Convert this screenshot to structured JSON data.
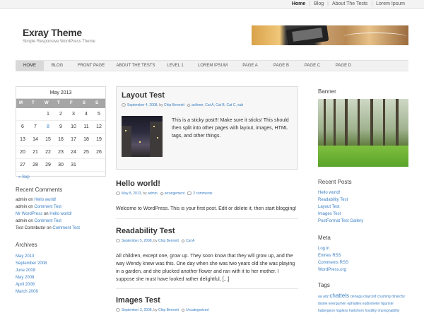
{
  "topnav": [
    "Home",
    "Blog",
    "About The Tests",
    "Lorem Ipsum"
  ],
  "site": {
    "title": "Exray Theme",
    "description": "Simple Responsive WordPress Theme"
  },
  "nav": [
    "HOME",
    "BLOG",
    "FRONT PAGE",
    "ABOUT THE TESTS",
    "LEVEL 1",
    "LOREM IPSUM",
    "PAGE A",
    "PAGE B",
    "PAGE C",
    "PAGE D"
  ],
  "calendar": {
    "caption": "May 2013",
    "days": [
      "M",
      "T",
      "W",
      "T",
      "F",
      "S",
      "S"
    ],
    "rows": [
      [
        "",
        "",
        "1",
        "2",
        "3",
        "4",
        "5"
      ],
      [
        "6",
        "7",
        "8",
        "9",
        "10",
        "11",
        "12"
      ],
      [
        "13",
        "14",
        "15",
        "16",
        "17",
        "18",
        "19"
      ],
      [
        "20",
        "21",
        "22",
        "23",
        "24",
        "25",
        "26"
      ],
      [
        "27",
        "28",
        "29",
        "30",
        "31",
        "",
        ""
      ]
    ],
    "linked_day": "8",
    "prev": "« Sep"
  },
  "recent_comments": {
    "title": "Recent Comments",
    "items": [
      {
        "author": "admin",
        "on": "on",
        "post": "Hello world!"
      },
      {
        "author": "admin",
        "on": "on",
        "post": "Comment Test"
      },
      {
        "author": "Mr WordPress",
        "on": "on",
        "post": "Hello world!"
      },
      {
        "author": "admin",
        "on": "on",
        "post": "Comment Test"
      },
      {
        "author": "Test Contributor",
        "on": "on",
        "post": "Comment Test"
      }
    ]
  },
  "archives": {
    "title": "Archives",
    "items": [
      "May 2013",
      "September 2008",
      "June 2008",
      "May 2008",
      "April 2008",
      "March 2008"
    ]
  },
  "posts": {
    "sticky": {
      "title": "Layout Test",
      "date": "September 4, 2008",
      "by": ", by",
      "author": "Chip Bennett",
      "cats": "aciform, Cat A, Cat B, Cat C, sub",
      "excerpt": "This is a sticky post!!! Make sure it sticks! This should then split into other pages with layout, images, HTML tags, and other things."
    },
    "hello": {
      "title": "Hello world!",
      "date": "May 8, 2013",
      "by": ", by",
      "author": "admin",
      "cats": "arrangement",
      "comments": "2 comments",
      "excerpt": "Welcome to WordPress. This is your first post. Edit or delete it, then start blogging!"
    },
    "readability": {
      "title": "Readability Test",
      "date": "September 5, 2008",
      "by": ", by",
      "author": "Chip Bennett",
      "cats": "Cat A",
      "excerpt": "All children, except one, grow up. They soon know that they will grow up, and the way Wendy knew was this. One day when she was two years old she was playing in a garden, and she plucked another flower and ran with it to her mother. I suppose she must have looked rather delightful, [...]"
    },
    "images": {
      "title": "Images Test",
      "date": "September 3, 2008",
      "by": ", by",
      "author": "Chip Bennett",
      "cats": "Uncategorized"
    }
  },
  "banner": {
    "title": "Banner"
  },
  "recent_posts": {
    "title": "Recent Posts",
    "items": [
      "Hello world!",
      "Readability Test",
      "Layout Test",
      "Images Test",
      "PostFormat Test Gallery"
    ]
  },
  "meta": {
    "title": "Meta",
    "items": [
      "Log in",
      "Entries RSS",
      "Comments RSS",
      "WordPress.org"
    ]
  },
  "tags": {
    "title": "Tags",
    "line1": [
      "aa",
      "adz"
    ],
    "big": "chattels",
    "line1b": [
      "cienaga",
      "claycold",
      "crushing",
      "dinarchy"
    ],
    "line2": [
      "doolie",
      "energumen",
      "ephialtes",
      "eudiometer",
      "figuriste"
    ],
    "line3": [
      "habergeon",
      "hapless",
      "hartshorn",
      "hostility",
      "impregnability"
    ]
  }
}
